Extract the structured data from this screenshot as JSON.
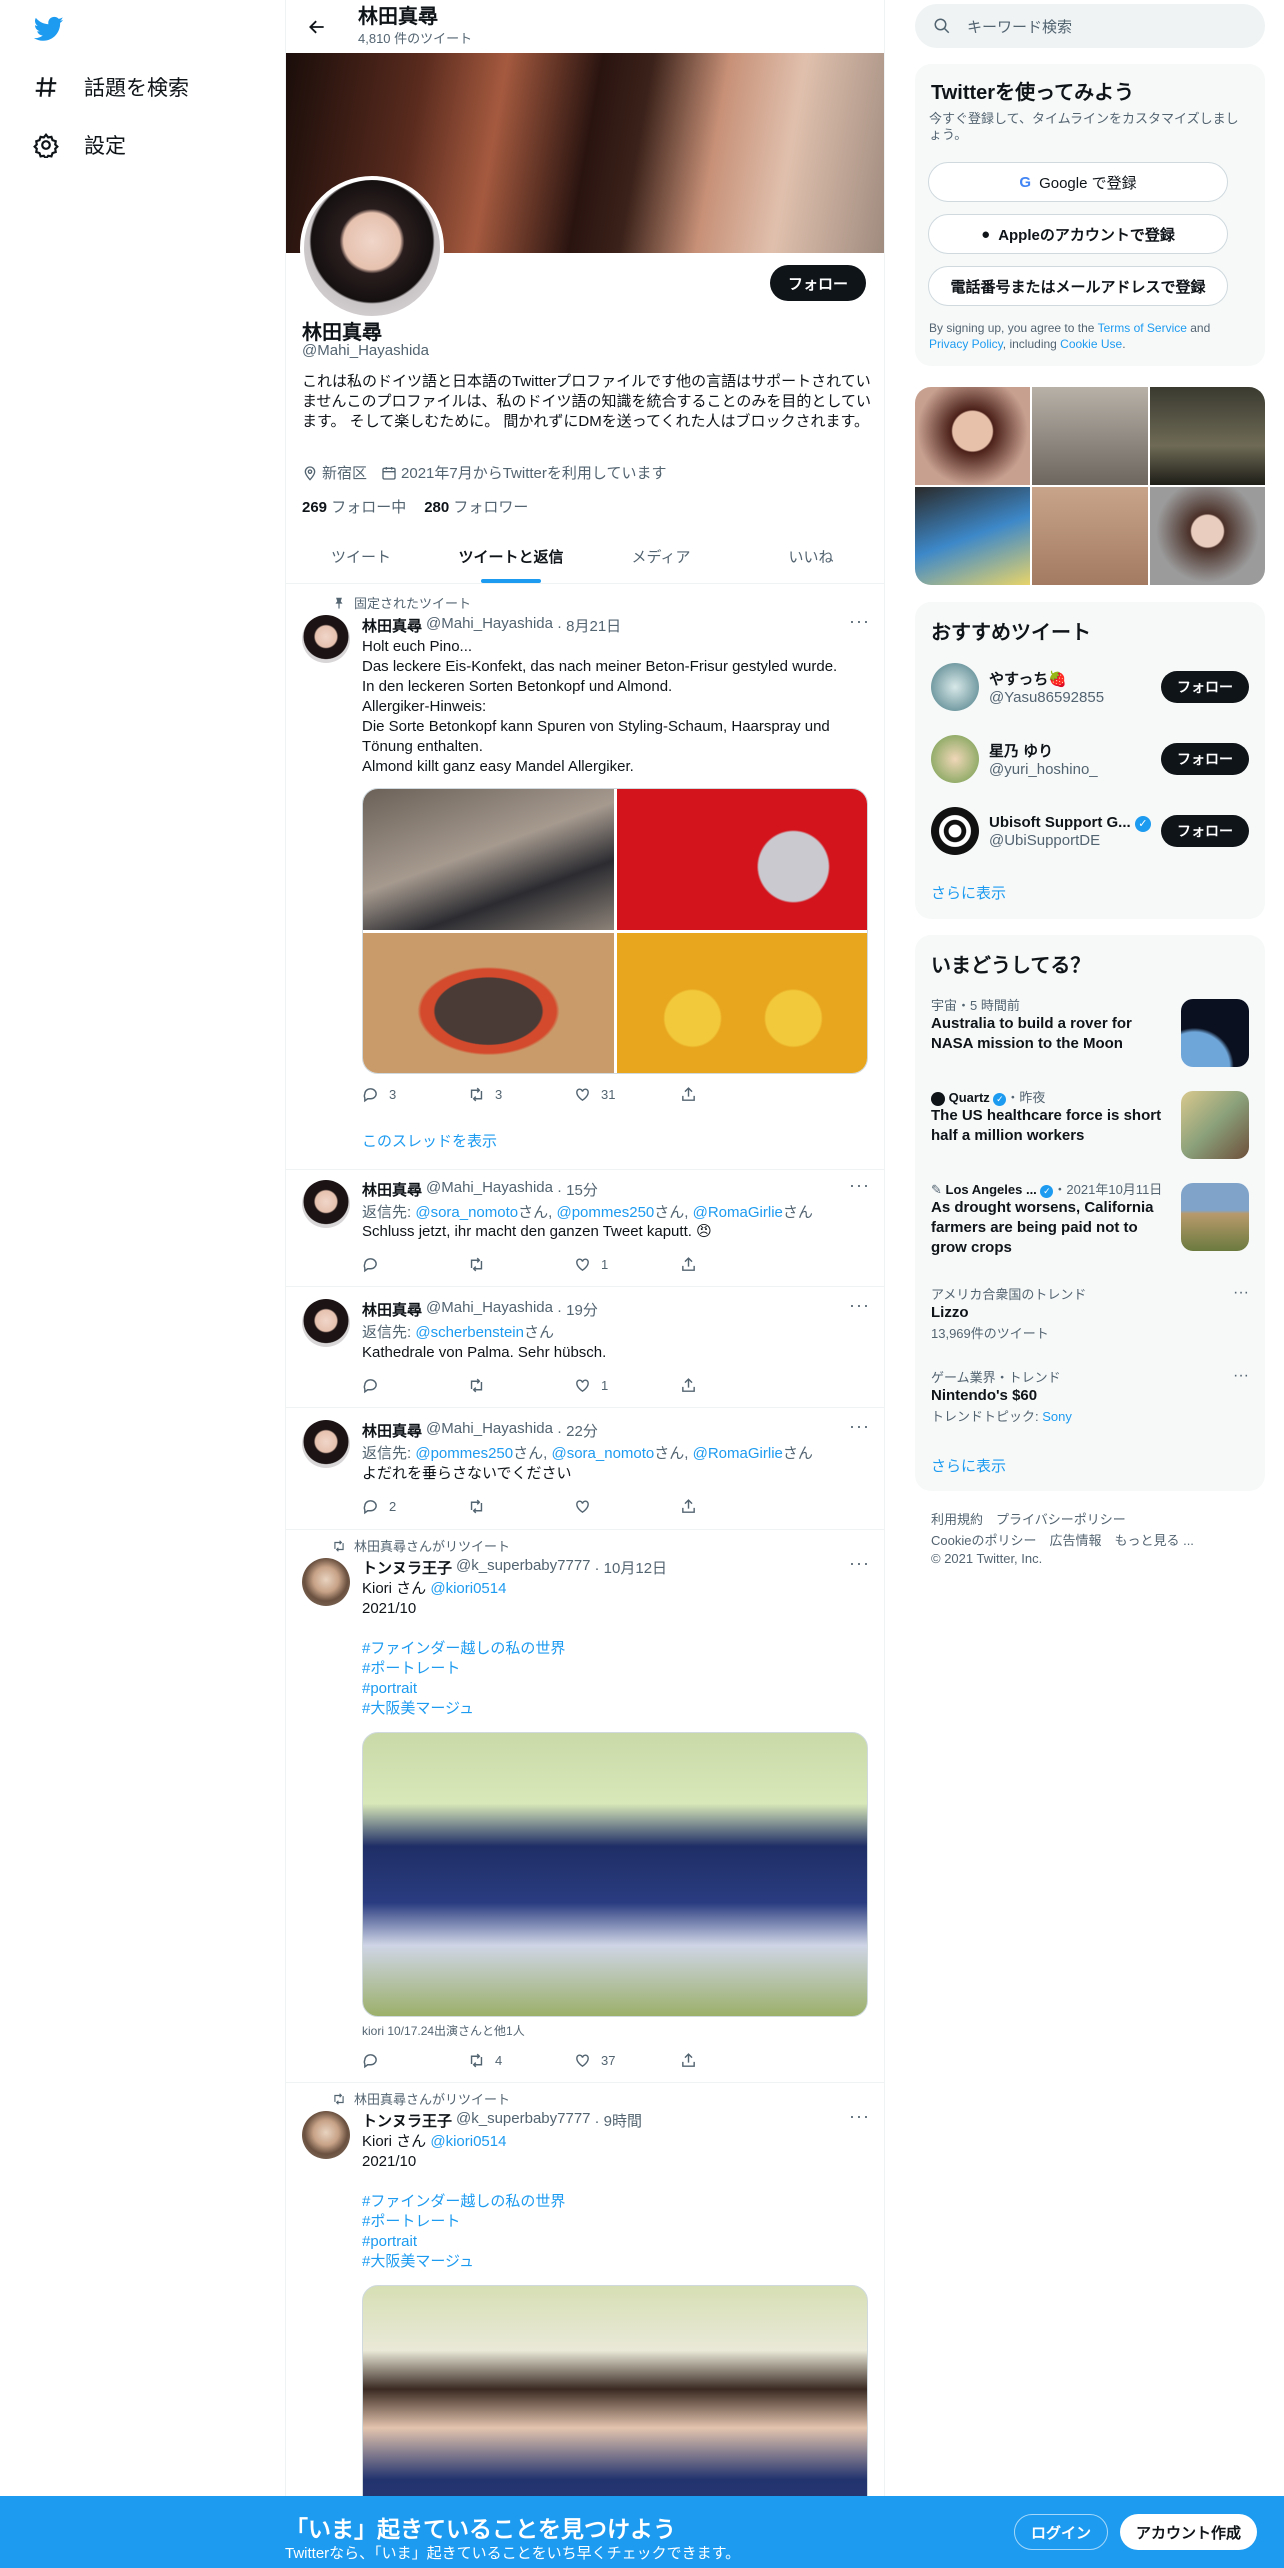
{
  "nav": {
    "explore_label": "話題を検索",
    "settings_label": "設定"
  },
  "header": {
    "name": "林田真尋",
    "tweet_count": "4,810 件のツイート"
  },
  "profile": {
    "follow_label": "フォロー",
    "name": "林田真尋",
    "handle": "@Mahi_Hayashida",
    "bio": "これは私のドイツ語と日本語のTwitterプロファイルです他の言語はサポートされていませんこのプロファイルは、私のドイツ語の知識を統合することのみを目的としています。 そして楽しむために。 間かれずにDMを送ってくれた人はブロックされます。",
    "location": "新宿区",
    "joined": "2021年7月からTwitterを利用しています",
    "following_count": "269",
    "following_label": "フォロー中",
    "followers_count": "280",
    "followers_label": "フォロワー"
  },
  "tabs": [
    "ツイート",
    "ツイートと返信",
    "メディア",
    "いいね"
  ],
  "tweets": [
    {
      "context": "固定されたツイート",
      "name": "林田真尋",
      "handle": "@Mahi_Hayashida",
      "time": "· 8月21日",
      "text": "Holt euch Pino...\nDas leckere Eis-Konfekt, das nach meiner Beton-Frisur gestyled wurde.\nIn den leckeren Sorten Betonkopf und Almond.\nAllergiker-Hinweis:\nDie Sorte Betonkopf kann Spuren von Styling-Schaum, Haarspray und Tönung enthalten.\nAlmond killt ganz easy Mandel Allergiker.",
      "replies": "3",
      "retweets": "3",
      "likes": "31",
      "show_thread": "このスレッドを表示"
    },
    {
      "name": "林田真尋",
      "handle": "@Mahi_Hayashida",
      "time": "· 15分",
      "reply_prefix": "返信先: ",
      "reply_to": [
        "@sora_nomoto",
        "@pommes250",
        "@RomaGirlie"
      ],
      "reply_suffix": "さん",
      "text": "Schluss jetzt, ihr macht den ganzen Tweet kaputt. 😠",
      "replies": "",
      "retweets": "",
      "likes": "1"
    },
    {
      "name": "林田真尋",
      "handle": "@Mahi_Hayashida",
      "time": "· 19分",
      "reply_prefix": "返信先: ",
      "reply_to": [
        "@scherbenstein"
      ],
      "reply_suffix": "さん",
      "text": "Kathedrale von Palma. Sehr hübsch.",
      "replies": "",
      "retweets": "",
      "likes": "1"
    },
    {
      "name": "林田真尋",
      "handle": "@Mahi_Hayashida",
      "time": "· 22分",
      "reply_prefix": "返信先: ",
      "reply_to": [
        "@pommes250",
        "@sora_nomoto",
        "@RomaGirlie"
      ],
      "reply_suffix": "さん",
      "text": "よだれを垂らさないでください",
      "replies": "2",
      "retweets": "",
      "likes": ""
    },
    {
      "context": "林田真尋さんがリツイート",
      "name": "トンヌラ王子",
      "handle": "@k_superbaby7777",
      "time": "· 10月12日",
      "line1_name": "Kiori さん",
      "line1_handle": "@kiori0514",
      "line2": "2021/10",
      "hashtags": [
        "#ファインダー越しの私の世界",
        "#ポートレート",
        "#portrait",
        "#大阪美マージュ"
      ],
      "caption": "kiori 10/17.24出演さんと他1人",
      "replies": "",
      "retweets": "4",
      "likes": "37"
    },
    {
      "context": "林田真尋さんがリツイート",
      "name": "トンヌラ王子",
      "handle": "@k_superbaby7777",
      "time": "· 9時間",
      "line1_name": "Kiori さん",
      "line1_handle": "@kiori0514",
      "line2": "2021/10",
      "hashtags": [
        "#ファインダー越しの私の世界",
        "#ポートレート",
        "#portrait",
        "#大阪美マージュ"
      ]
    }
  ],
  "right": {
    "search_placeholder": "キーワード検索",
    "signup": {
      "title": "Twitterを使ってみよう",
      "subtitle": "今すぐ登録して、タイムラインをカスタマイズしましょう。",
      "google": "Google で登録",
      "apple": "Appleのアカウントで登録",
      "phone": "電話番号またはメールアドレスで登録",
      "terms_prefix": "By signing up, you agree to the ",
      "terms": "Terms of Service",
      "and": " and ",
      "privacy": "Privacy Policy",
      "including": ", including ",
      "cookie": "Cookie Use",
      "period": "."
    },
    "who_to_follow": {
      "title": "おすすめツイート",
      "follow_label": "フォロー",
      "show_more": "さらに表示",
      "users": [
        {
          "name": "やすっち🍓",
          "handle": "@Yasu86592855"
        },
        {
          "name": "星乃 ゆり",
          "handle": "@yuri_hoshino_"
        },
        {
          "name": "Ubisoft Support G...",
          "handle": "@UbiSupportDE"
        }
      ]
    },
    "happening": {
      "title": "いまどうしてる？",
      "show_more": "さらに表示",
      "items": [
        {
          "meta": "宇宙・5 時間前",
          "title": "Australia to build a rover for NASA mission to the Moon"
        },
        {
          "meta_source": "Quartz",
          "meta_time": "・昨夜",
          "title": "The US healthcare force is short half a million workers"
        },
        {
          "meta_source": "Los Angeles ...",
          "meta_time": "・2021年10月11日",
          "title": "As drought worsens, California farmers are being paid not to grow crops"
        },
        {
          "meta": "アメリカ合衆国のトレンド",
          "title": "Lizzo",
          "sub": "13,969件のツイート"
        },
        {
          "meta": "ゲーム業界・トレンド",
          "title": "Nintendo's $60",
          "sub_prefix": "トレンドトピック: ",
          "sub_link": "Sony"
        }
      ]
    },
    "footer": {
      "links1": "利用規約　プライバシーポリシー",
      "links2": "Cookieのポリシー　広告情報　もっと見る ...",
      "copyright": "© 2021 Twitter, Inc."
    }
  },
  "bottom": {
    "title": "「いま」起きていることを見つけよう",
    "subtitle": "Twitterなら、「いま」起きていることをいち早くチェックできます。",
    "login": "ログイン",
    "signup": "アカウント作成"
  },
  "colors": {
    "accent": "#1d9bf0",
    "text": "#0f1419",
    "secondary": "#536471"
  }
}
